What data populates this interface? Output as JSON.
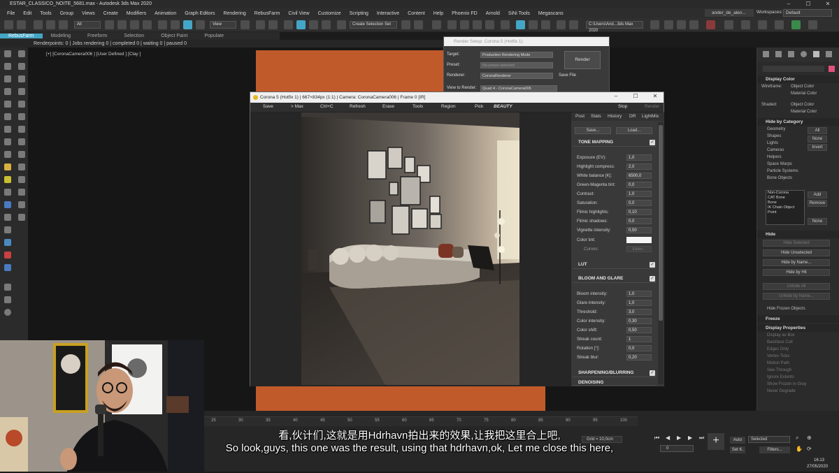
{
  "window": {
    "title": "ESTAR_CLASSICO_NOITE_5681.max - Autodesk 3ds Max 2020",
    "controls": [
      "–",
      "☐",
      "✕"
    ]
  },
  "menu": [
    "File",
    "Edit",
    "Tools",
    "Group",
    "Views",
    "Create",
    "Modifiers",
    "Animation",
    "Graph Editors",
    "Rendering",
    "RebusFarm",
    "Civil View",
    "Customize",
    "Scripting",
    "Interactive",
    "Content",
    "Help",
    "Phoenix FD",
    "Arnold",
    "SiNi Tools",
    "Megascans"
  ],
  "user": {
    "name": "ander_de_alen...",
    "workspaces_label": "Workspaces:",
    "workspace": "Default"
  },
  "toolbar": {
    "selection_filter": "All",
    "ref_coord": "View",
    "named_selection": "Create Selection Set",
    "path_field": "C:\\Users\\And...3ds Max 2020"
  },
  "ribbon": {
    "tabs": [
      "RebusFarm",
      "Modeling",
      "Freeform",
      "Selection",
      "Object Paint",
      "Populate"
    ],
    "active": 0
  },
  "status_line": "Renderpoints: 0 | Jobs rendering 0 | completed 0 | waiting 0 | paused 0",
  "viewport": {
    "label": "[+] [CoronaCamera006 ] [User Defined ] [Clay ]"
  },
  "render_setup": {
    "title": "Render Setup: Corona 5 (Hotfix 1)",
    "target_label": "Target:",
    "target": "Production Rendering Mode",
    "preset_label": "Preset:",
    "preset": "No preset selected",
    "renderer_label": "Renderer:",
    "renderer": "CoronaRenderer",
    "save_file": "Save File",
    "view_label": "View to Render:",
    "view": "Quad 4 - CoronaCamera006",
    "render_button": "Render"
  },
  "vfb": {
    "title": "Corona 5 (Hotfix 1) | 667×834px (1:1) | Camera: CoronaCamera006 | Frame 0 [IR]",
    "tools": [
      "Save",
      "> Max",
      "Ctrl+C",
      "Refresh",
      "Erase",
      "Tools",
      "Region",
      "Pick"
    ],
    "channel": "BEAUTY",
    "stop": "Stop",
    "render": "Render",
    "tabs": [
      "Post",
      "Stats",
      "History",
      "DR",
      "LightMix"
    ],
    "save": "Save...",
    "load": "Load...",
    "tone_mapping": {
      "header": "TONE MAPPING",
      "params": [
        {
          "label": "Exposure (EV):",
          "value": "1,0"
        },
        {
          "label": "Highlight compress:",
          "value": "2,0"
        },
        {
          "label": "White balance [K]:",
          "value": "6500,0"
        },
        {
          "label": "Green-Magenta tint:",
          "value": "0,0"
        },
        {
          "label": "Contrast:",
          "value": "1,0"
        },
        {
          "label": "Saturation:",
          "value": "0,0"
        },
        {
          "label": "Filmic highlights:",
          "value": "0,10"
        },
        {
          "label": "Filmic shadows:",
          "value": "0,0"
        },
        {
          "label": "Vignette intensity:",
          "value": "0,50"
        }
      ],
      "color_tint": "Color tint:",
      "curves": "Curves:",
      "editor": "Editor..."
    },
    "lut": "LUT",
    "bloom": {
      "header": "BLOOM AND GLARE",
      "params": [
        {
          "label": "Bloom intensity:",
          "value": "1,0"
        },
        {
          "label": "Glare intensity:",
          "value": "1,0"
        },
        {
          "label": "Threshold:",
          "value": "3,0"
        },
        {
          "label": "Color intensity:",
          "value": "0,30"
        },
        {
          "label": "Color shift:",
          "value": "0,50"
        },
        {
          "label": "Streak count:",
          "value": "1"
        },
        {
          "label": "Rotation [°]:",
          "value": "0,0"
        },
        {
          "label": "Streak blur:",
          "value": "0,20"
        }
      ]
    },
    "sharpening": "SHARPENING/BLURRING",
    "denoising": "DENOISING"
  },
  "right_panel": {
    "display_color": "Display Color",
    "wireframe_label": "Wireframe:",
    "shaded_label": "Shaded:",
    "object_color": "Object Color",
    "material_color": "Material Color",
    "hide_by_category": "Hide by Category",
    "categories": [
      "Geometry",
      "Shapes",
      "Lights",
      "Cameras",
      "Helpers",
      "Space Warps",
      "Particle Systems",
      "Bone Objects"
    ],
    "cat_buttons": [
      "All",
      "None",
      "Invert"
    ],
    "list_items": [
      "Non-Corona",
      "CAT Bone",
      "Bone",
      "IK Chain Object",
      "Point"
    ],
    "list_buttons": [
      "Add",
      "Remove",
      "None"
    ],
    "hide": "Hide",
    "hide_buttons": [
      "Hide Selected",
      "Hide Unselected",
      "Hide by Name...",
      "Hide by Hit",
      "Unhide All",
      "Unhide by Name..."
    ],
    "hide_frozen": "Hide Frozen Objects",
    "freeze": "Freeze",
    "display_properties": "Display Properties",
    "disp_items": [
      "Display as Box",
      "Backface Cull",
      "Edges Only",
      "Vertex Ticks",
      "Motion Path",
      "See-Through",
      "Ignore Extents",
      "Show Frozen in Gray",
      "Never Degrade"
    ]
  },
  "timeline": {
    "ticks": [
      "25",
      "30",
      "35",
      "40",
      "45",
      "50",
      "55",
      "60",
      "65",
      "70",
      "75",
      "80",
      "85",
      "90",
      "95",
      "100"
    ],
    "grid": "Grid = 10,0cm",
    "auto": "Auto",
    "selected": "Selected",
    "setk": "Set K.",
    "filters": "Filters...",
    "frame": "0"
  },
  "subtitles": {
    "zh": "看,伙计们,这就是用Hdrhavn拍出来的效果,让我把这里合上吧,",
    "en": "So look,guys, this one was the result, using that hdrhavn,ok, Let me close this here,"
  },
  "clock": {
    "time": "16:13",
    "date": "27/05/2020"
  },
  "colors": {
    "accent": "#44a6c6",
    "floor": "#c15a2a",
    "pink": "#e0507a"
  }
}
